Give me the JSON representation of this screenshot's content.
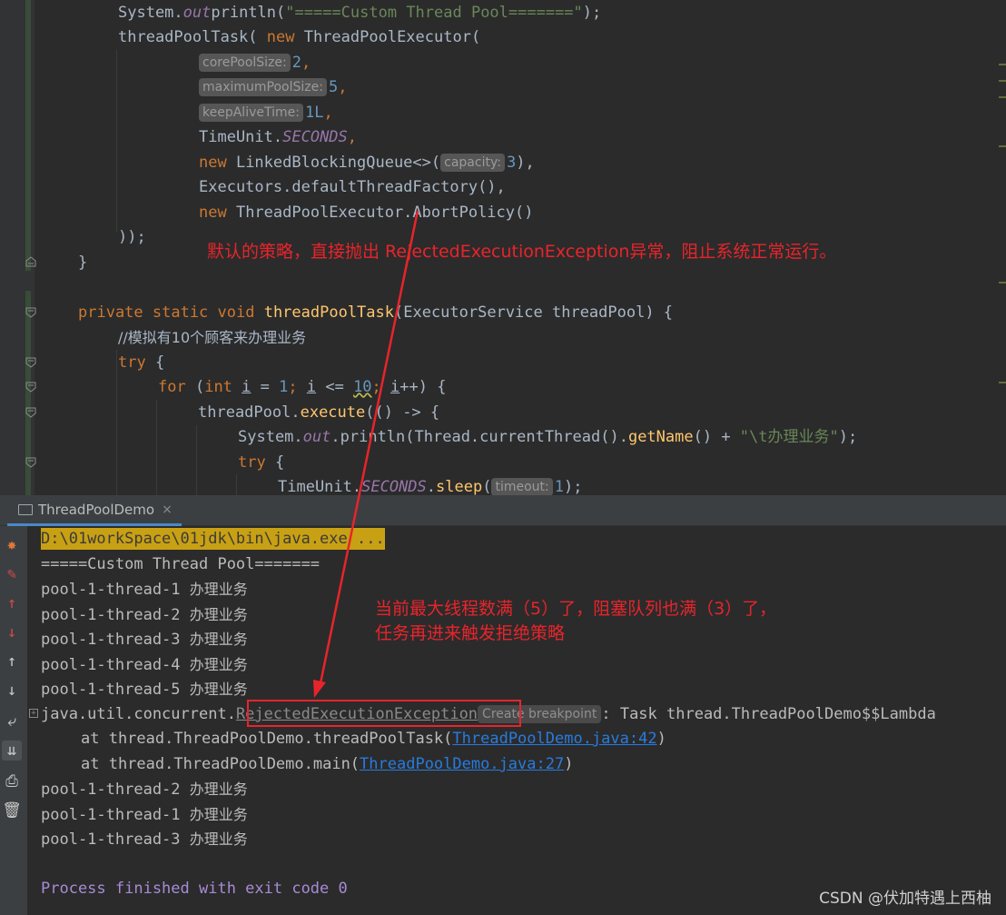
{
  "editor": {
    "lines": {
      "l1": {
        "a": "System.",
        "b": "out",
        ".": ".",
        "c": "println(",
        "d": "\"=====Custom Thread Pool=======\"",
        "e": ");"
      },
      "l2": {
        "a": "threadPoolTask( ",
        "b": "new ",
        "c": "ThreadPoolExecutor("
      },
      "l3": {
        "hint": "corePoolSize:",
        "val": "2",
        "tail": ","
      },
      "l4": {
        "hint": "maximumPoolSize:",
        "val": "5",
        "tail": ","
      },
      "l5": {
        "hint": "keepAliveTime:",
        "val": "1L",
        "tail": ","
      },
      "l6": {
        "a": "TimeUnit.",
        "b": "SECONDS",
        "c": ","
      },
      "l7": {
        "a": "new ",
        "b": "LinkedBlockingQueue",
        "c": "<>(",
        "hint": "capacity:",
        "val": "3",
        "d": "),"
      },
      "l8": {
        "a": "Executors.",
        "b": "defaultThreadFactory",
        "c": "(),"
      },
      "l9": {
        "a": "new ",
        "b": "ThreadPoolExecutor.",
        "c": "AbortPolicy",
        "d": "()"
      },
      "l10": {
        "a": "));"
      },
      "l11": {
        "a": "}"
      },
      "l12": {
        "a": "private static void ",
        "b": "threadPoolTask",
        "c": "(ExecutorService threadPool) {"
      },
      "l13": {
        "a": "//模拟有10个顾客来办理业务"
      },
      "l14": {
        "a": "try ",
        "b": "{"
      },
      "l15": {
        "a": "for ",
        "b": "(",
        "c": "int ",
        "d": "i",
        "e": " = ",
        "f": "1",
        "g": "; ",
        "h": "i",
        "i": " <= ",
        "j": "10",
        "k": "; ",
        "l": "i",
        "m": "++) {"
      },
      "l16": {
        "a": "threadPool.",
        "b": "execute",
        "c": "(() -> {"
      },
      "l17": {
        "a": "System.",
        "b": "out",
        "c": ".",
        "d": "println",
        "e": "(Thread.",
        "f": "currentThread",
        "g": "().",
        "h": "getName",
        "i": "() + ",
        "j": "\"\\t办理业务\"",
        "k": ");"
      },
      "l18": {
        "a": "try ",
        "b": "{"
      },
      "l19": {
        "a": "TimeUnit.",
        "b": "SECONDS",
        "c": ".",
        "d": "sleep",
        "e": "(",
        "hint": "timeout:",
        "val": "1",
        "f": ");"
      }
    }
  },
  "run": {
    "tab_label": "ThreadPoolDemo",
    "tab_close": "×",
    "cmd": "D:\\01workSpace\\01jdk\\bin\\java.exe ...",
    "header": "=====Custom Thread Pool=======",
    "thread_prefix": [
      "pool-1-thread-1",
      "pool-1-thread-2",
      "pool-1-thread-3",
      "pool-1-thread-4",
      "pool-1-thread-5"
    ],
    "work_text": "办理业务",
    "exception": {
      "pkg": "java.util.concurrent.",
      "name": "RejectedExecutionException",
      "hint": "Create breakpoint",
      "rest": ": Task thread.ThreadPoolDemo$$Lambda"
    },
    "stack": [
      {
        "prefix": "at thread.ThreadPoolDemo.threadPoolTask(",
        "link": "ThreadPoolDemo.java:42",
        "suffix": ")"
      },
      {
        "prefix": "at thread.ThreadPoolDemo.main(",
        "link": "ThreadPoolDemo.java:27",
        "suffix": ")"
      }
    ],
    "after": [
      "pool-1-thread-2",
      "pool-1-thread-1",
      "pool-1-thread-3"
    ],
    "exit": "Process finished with exit code 0"
  },
  "annotations": {
    "policy": "默认的策略，直接抛出 RejectedExecutionException异常，阻止系统正常运行。",
    "full_line1": "当前最大线程数满（5）了，阻塞队列也满（3）了，",
    "full_line2": "任务再进来触发拒绝策略"
  },
  "watermark": "CSDN @伏加特遇上西柚",
  "colors": {
    "accent": "#e8242b",
    "keyword": "#cc7832",
    "string": "#6a8759",
    "number": "#6897bb",
    "method": "#ffc66d",
    "field": "#9876aa"
  }
}
